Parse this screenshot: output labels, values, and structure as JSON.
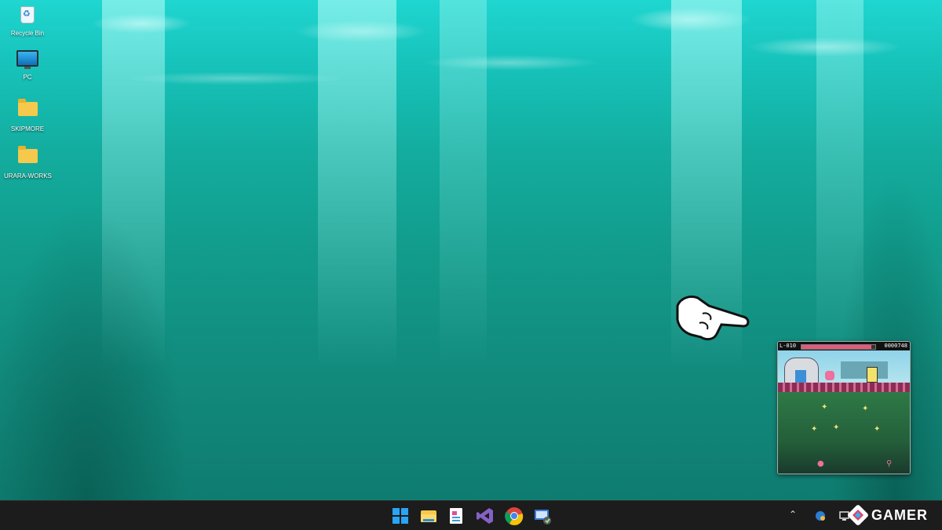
{
  "desktop": {
    "icons": [
      {
        "label": "Recycle Bin",
        "icon": "recycle-bin-icon"
      },
      {
        "label": "PC",
        "icon": "monitor-icon"
      },
      {
        "label": "SKIPMORE",
        "icon": "folder-icon"
      },
      {
        "label": "URARA-WORKS",
        "icon": "folder-icon"
      }
    ]
  },
  "game_window": {
    "level": "L-010",
    "hp_fraction": 0.95,
    "score": "0000748"
  },
  "taskbar": {
    "apps": [
      "start-icon",
      "file-explorer-icon",
      "notepad-icon",
      "visual-studio-icon",
      "chrome-icon",
      "remote-desktop-icon"
    ],
    "tray": [
      "chevron-up-icon",
      "network-icon",
      "speaker-icon"
    ]
  },
  "watermark": {
    "text": "GAMER"
  },
  "colors": {
    "taskbar_bg": "#1c1c1c",
    "water_top": "#1fd6d0",
    "water_bottom": "#0f7c70"
  }
}
